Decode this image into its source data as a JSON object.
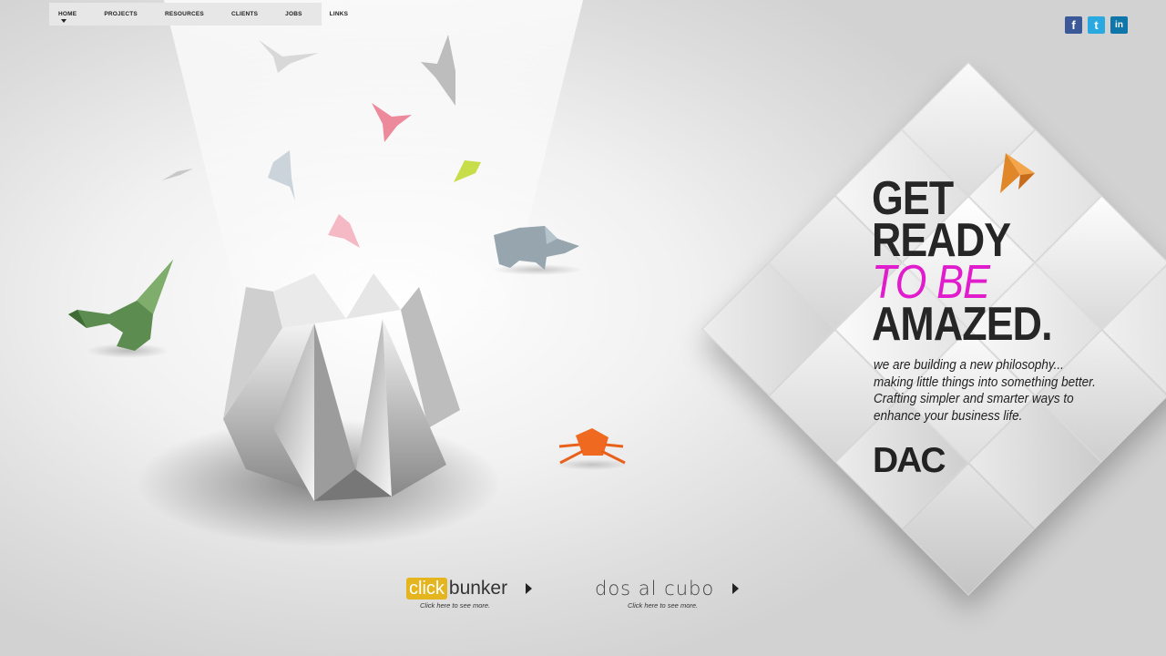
{
  "nav": {
    "items": [
      {
        "label": "HOME",
        "active": true
      },
      {
        "label": "PROJECTS"
      },
      {
        "label": "RESOURCES"
      },
      {
        "label": "CLIENTS"
      },
      {
        "label": "JOBS"
      },
      {
        "label": "LINKS"
      }
    ]
  },
  "social": [
    {
      "name": "facebook-icon",
      "glyph": "f",
      "color": "#3b5998"
    },
    {
      "name": "twitter-icon",
      "glyph": "t",
      "color": "#2aa9e0"
    },
    {
      "name": "linkedin-icon",
      "glyph": "in",
      "color": "#0e76a8"
    }
  ],
  "hero": {
    "line1": "GET",
    "line2": "READY",
    "line3": "TO BE",
    "line4": "AMAZED.",
    "accent_color": "#e01ccd",
    "tagline": [
      "we are building a new philosophy...",
      "making little things into something better.",
      "Crafting simpler and smarter ways to",
      "enhance your business life."
    ],
    "logo": "DAC"
  },
  "promos": [
    {
      "logo_a": "click",
      "logo_b": "bunker",
      "caption": "Click here to see more."
    },
    {
      "logo": "dos al cubo",
      "caption": "Click here to see more."
    }
  ]
}
